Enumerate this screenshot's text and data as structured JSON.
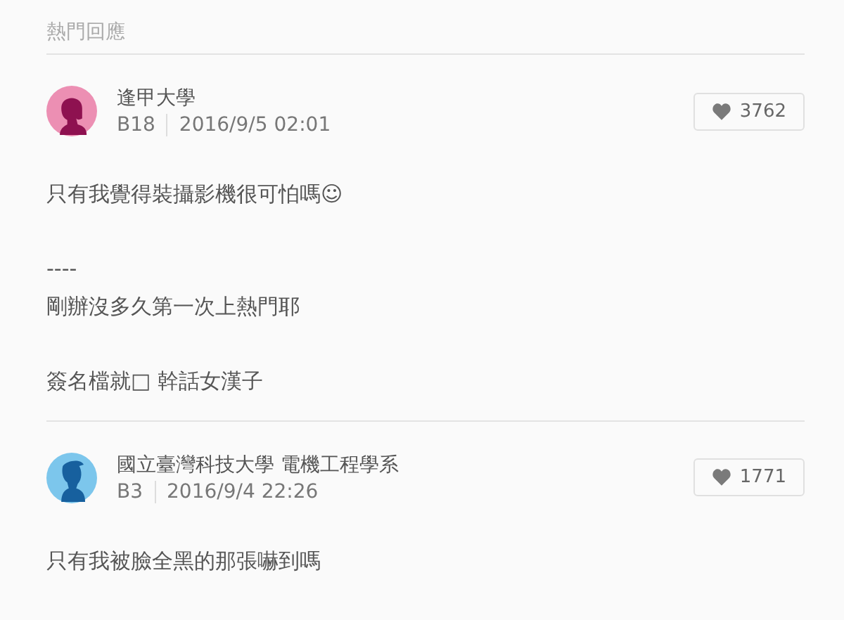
{
  "section_title": "熱門回應",
  "comments": [
    {
      "avatar": {
        "kind": "female"
      },
      "author": "逢甲大學",
      "floor": "B18",
      "time": "2016/9/5 02:01",
      "likes": "3762",
      "paragraphs": [
        [
          "只有我覺得裝攝影機很可怕嗎☺"
        ],
        [
          "----",
          "剛辦沒多久第一次上熱門耶"
        ],
        [
          "簽名檔就□ 幹話女漢子"
        ]
      ]
    },
    {
      "avatar": {
        "kind": "male"
      },
      "author": "國立臺灣科技大學 電機工程學系",
      "floor": "B3",
      "time": "2016/9/4 22:26",
      "likes": "1771",
      "paragraphs": [
        [
          "只有我被臉全黑的那張嚇到嗎"
        ]
      ]
    }
  ]
}
